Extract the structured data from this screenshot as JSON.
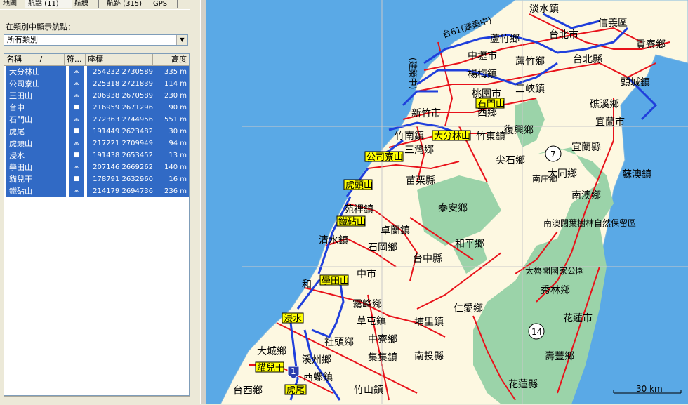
{
  "tabs": [
    "地圖",
    "航點 (11)",
    "航線",
    "航跡 (315)",
    "GPS"
  ],
  "filter_label": "在類別中顯示航點：",
  "category_value": "所有類別",
  "columns": {
    "name": "名稱",
    "sort_arrow": "/",
    "symbol": "符...",
    "coord": "座標",
    "elev": "高度"
  },
  "waypoints": [
    {
      "name": "大分林山",
      "symbol": "mountain",
      "coord": "254232 2730589",
      "elev": "335 m"
    },
    {
      "name": "公司寮山",
      "symbol": "mountain",
      "coord": "225318 2721839",
      "elev": "114 m"
    },
    {
      "name": "王田山",
      "symbol": "mountain",
      "coord": "206938 2670589",
      "elev": "230 m"
    },
    {
      "name": "台中",
      "symbol": "square",
      "coord": "216959 2671296",
      "elev": "90 m"
    },
    {
      "name": "石門山",
      "symbol": "mountain",
      "coord": "272363 2744956",
      "elev": "551 m"
    },
    {
      "name": "虎尾",
      "symbol": "square",
      "coord": "191449 2623482",
      "elev": "30 m"
    },
    {
      "name": "虎頭山",
      "symbol": "mountain",
      "coord": "217221 2709949",
      "elev": "94 m"
    },
    {
      "name": "浸水",
      "symbol": "square",
      "coord": "191438 2653452",
      "elev": "13 m"
    },
    {
      "name": "學田山",
      "symbol": "mountain",
      "coord": "207146 2669262",
      "elev": "140 m"
    },
    {
      "name": "貓兒干",
      "symbol": "square",
      "coord": "178791 2632960",
      "elev": "16 m"
    },
    {
      "name": "鐵砧山",
      "symbol": "mountain",
      "coord": "214179 2694736",
      "elev": "236 m"
    }
  ],
  "map": {
    "labels": {
      "tamsui": "淡水鎮",
      "xinyi": "信義區",
      "taipei_city": "台北市",
      "taipei_county": "台北縣",
      "gongliao": "貢寮鄉",
      "toucheng": "頭城鎮",
      "jiaoxi": "礁溪鄉",
      "yilan_city": "宜蘭市",
      "yilan_county": "宜蘭縣",
      "suao": "蘇澳鎮",
      "datong": "大同鄉",
      "nanao": "南澳鄉",
      "luzhu": "蘆竹鄉",
      "taoyuan_city": "桃園市",
      "yangmei": "楊梅鎮",
      "zhongli": "中壢市",
      "taoyuan_county": "桃園縣",
      "sanxia": "三峽鎮",
      "xinzhu_city": "新竹市",
      "xinpu": "西鄉",
      "fuxing": "復興鄉",
      "zhunan": "竹南鎮",
      "sanwan": "三灣鄉",
      "jianshi": "尖石鄉",
      "nanzhuang": "南庄鄉",
      "miaoli_county": "苗栗縣",
      "taian": "泰安鄉",
      "yuanli": "苑裡鎮",
      "zhuolan": "卓蘭鎮",
      "qingshui": "清水鎮",
      "shigang": "石岡鄉",
      "heping": "和平鄉",
      "taichung_county": "台中縣",
      "taichung_city": "中市",
      "nanao_reserve": "南澳闊葉樹林自然保留區",
      "taroko": "太魯閣國家公園",
      "xiulin": "秀林鄉",
      "hualien_city": "花蓮市",
      "hualien_county": "花蓮縣",
      "shoufeng": "壽豐鄉",
      "wufeng": "霧峰鄉",
      "caotun": "草屯鎮",
      "puli": "埔里鎮",
      "renai": "仁愛鄉",
      "shetou": "社頭鄉",
      "zhongliao": "中寮鄉",
      "jiji": "集集鎮",
      "nantou_county": "南投縣",
      "dacheng": "大城鄉",
      "xizhou": "溪州鄉",
      "xiluo": "西螺鎮",
      "taixi": "台西鄉",
      "zhushan": "竹山鎮",
      "he": "和",
      "hsinchu_label": "竹市",
      "zhudong": "竹東鎮",
      "hwy61": "台61(建築中)",
      "hwy61b": "(建築中)",
      "route7": "7",
      "route14": "14",
      "route1": "1",
      "scale": "30 km"
    },
    "waypoint_tags": [
      "大分林山",
      "石門山",
      "公司寮山",
      "虎頭山",
      "鐵砧山",
      "學田山",
      "浸水",
      "貓兒干",
      "虎尾"
    ]
  },
  "colors": {
    "sea": "#5aa9e6",
    "land": "#fdf8e1",
    "forest": "#9bd3a9",
    "road": "#e8121a",
    "track": "#1f3fdc",
    "selection": "#316ac5"
  }
}
